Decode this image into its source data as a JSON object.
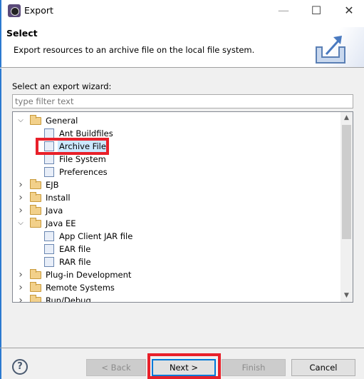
{
  "window": {
    "title": "Export",
    "minimize": "—",
    "maximize": "☐",
    "close": "✕"
  },
  "header": {
    "title": "Select",
    "description": "Export resources to an archive file on the local file system."
  },
  "wizard": {
    "label": "Select an export wizard:",
    "filter_placeholder": "type filter text",
    "filter_value": ""
  },
  "tree": [
    {
      "label": "General",
      "level": 0,
      "expanded": true,
      "type": "folder"
    },
    {
      "label": "Ant Buildfiles",
      "level": 1,
      "type": "ant"
    },
    {
      "label": "Archive File",
      "level": 1,
      "type": "archive",
      "selected": true,
      "highlighted": true
    },
    {
      "label": "File System",
      "level": 1,
      "type": "filesystem"
    },
    {
      "label": "Preferences",
      "level": 1,
      "type": "preferences"
    },
    {
      "label": "EJB",
      "level": 0,
      "expanded": false,
      "type": "folder"
    },
    {
      "label": "Install",
      "level": 0,
      "expanded": false,
      "type": "folder"
    },
    {
      "label": "Java",
      "level": 0,
      "expanded": false,
      "type": "folder"
    },
    {
      "label": "Java EE",
      "level": 0,
      "expanded": true,
      "type": "folder"
    },
    {
      "label": "App Client JAR file",
      "level": 1,
      "type": "jar"
    },
    {
      "label": "EAR file",
      "level": 1,
      "type": "ear"
    },
    {
      "label": "RAR file",
      "level": 1,
      "type": "rar"
    },
    {
      "label": "Plug-in Development",
      "level": 0,
      "expanded": false,
      "type": "folder"
    },
    {
      "label": "Remote Systems",
      "level": 0,
      "expanded": false,
      "type": "folder"
    },
    {
      "label": "Run/Debug",
      "level": 0,
      "expanded": false,
      "type": "folder"
    }
  ],
  "buttons": {
    "help": "?",
    "back": "< Back",
    "next": "Next >",
    "finish": "Finish",
    "cancel": "Cancel"
  },
  "colors": {
    "highlight": "#e8202a",
    "selection": "#cce8ff",
    "focus": "#0078d7"
  }
}
